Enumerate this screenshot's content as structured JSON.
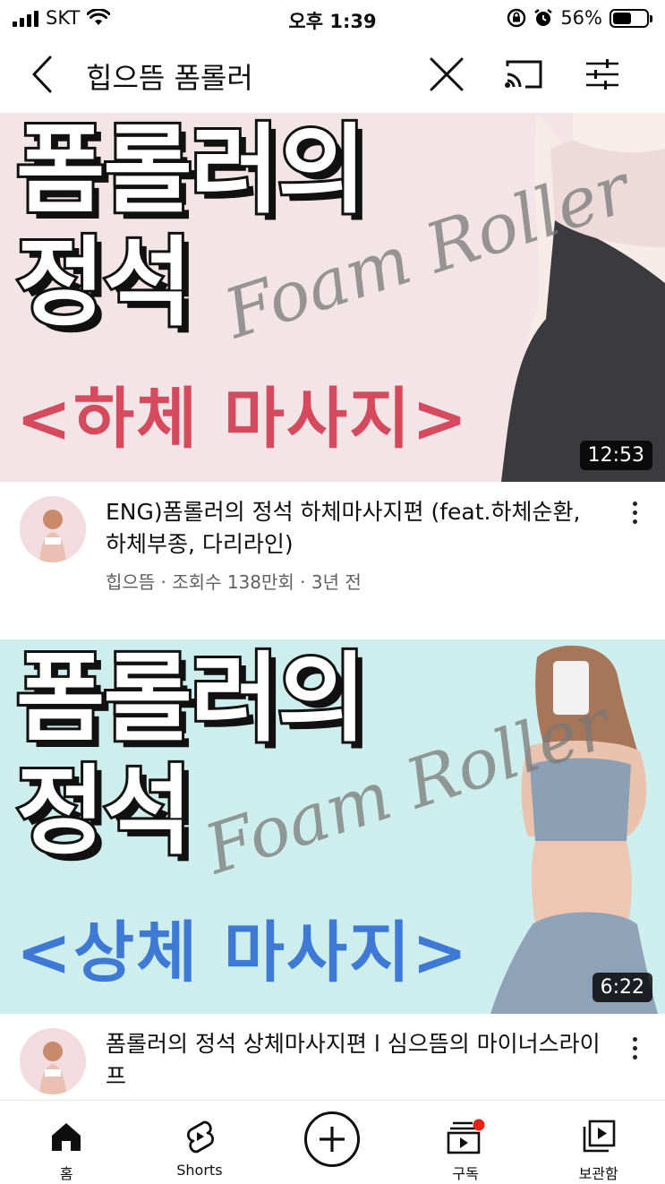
{
  "status_bar": {
    "carrier": "SKT",
    "time": "오후 1:39",
    "battery": "56%",
    "battery_level": 0.56,
    "icons": [
      "signal-icon",
      "wifi-icon",
      "rotation-lock-icon",
      "alarm-icon",
      "battery-icon"
    ]
  },
  "header": {
    "search_query": "힙으뜸 폼롤러",
    "icons": [
      "back-icon",
      "clear-icon",
      "cast-icon",
      "filter-icon"
    ]
  },
  "videos": [
    {
      "thumb_title_line1": "폼롤러의",
      "thumb_title_line2": "정석",
      "thumb_subtitle": "<하체 마사지>",
      "thumb_script": "Foam Roller",
      "duration": "12:53",
      "title": "ENG)폼롤러의 정석 하체마사지편 (feat.하체순환, 하체부종, 다리라인)",
      "channel_stats": "힙으뜸 · 조회수 138만회 · 3년 전",
      "bg_color": "#f3e4e7",
      "accent_color": "#d64a5e"
    },
    {
      "thumb_title_line1": "폼롤러의",
      "thumb_title_line2": "정석",
      "thumb_subtitle": "<상체 마사지>",
      "thumb_script": "Foam Roller",
      "duration": "6:22",
      "title": "폼롤러의 정석 상체마사지편 l 심으뜸의 마이너스라이프",
      "bg_color": "#cdeeed",
      "accent_color": "#3f79d6"
    }
  ],
  "bottom_nav": {
    "items": [
      {
        "label": "홈",
        "icon": "home-icon"
      },
      {
        "label": "Shorts",
        "icon": "shorts-icon"
      },
      {
        "label": "",
        "icon": "create-plus-icon"
      },
      {
        "label": "구독",
        "icon": "subscriptions-icon"
      },
      {
        "label": "보관함",
        "icon": "library-icon"
      }
    ]
  }
}
